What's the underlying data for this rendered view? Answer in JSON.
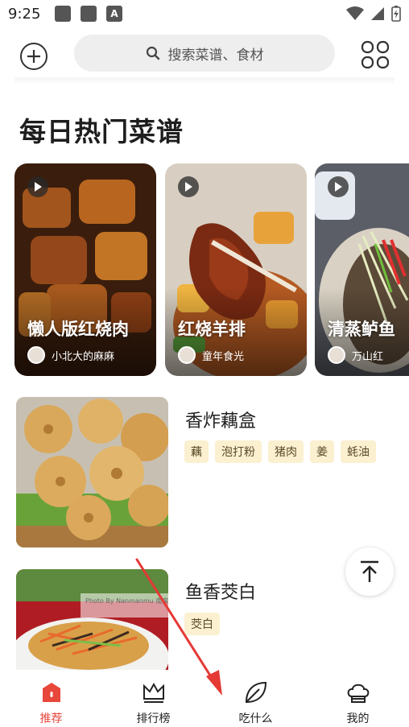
{
  "status": {
    "time": "9:25",
    "badge": "A"
  },
  "search": {
    "placeholder": "搜索菜谱、食材"
  },
  "section": {
    "title": "每日热门菜谱"
  },
  "hot_recipes": [
    {
      "title": "懒人版红烧肉",
      "author": "小北大的麻麻"
    },
    {
      "title": "红烧羊排",
      "author": "童年食光"
    },
    {
      "title": "清蒸鲈鱼",
      "author": "万山红"
    }
  ],
  "recipes": [
    {
      "title": "香炸藕盒",
      "tags": [
        "藕",
        "泡打粉",
        "猪肉",
        "姜",
        "蚝油"
      ]
    },
    {
      "title": "鱼香茭白",
      "tags": [
        "茭白"
      ]
    }
  ],
  "watermark": "Photo By Nanmanmu 南蛮妹",
  "nav": {
    "items": [
      {
        "label": "推荐",
        "icon": "home-icon",
        "active": true
      },
      {
        "label": "排行榜",
        "icon": "crown-icon",
        "active": false
      },
      {
        "label": "吃什么",
        "icon": "leaf-icon",
        "active": false
      },
      {
        "label": "我的",
        "icon": "chef-hat-icon",
        "active": false
      }
    ]
  },
  "colors": {
    "accent": "#e8473b",
    "tag_bg": "#fbf0cf",
    "search_bg": "#eeeeee",
    "annotation_arrow": "#e53935"
  }
}
